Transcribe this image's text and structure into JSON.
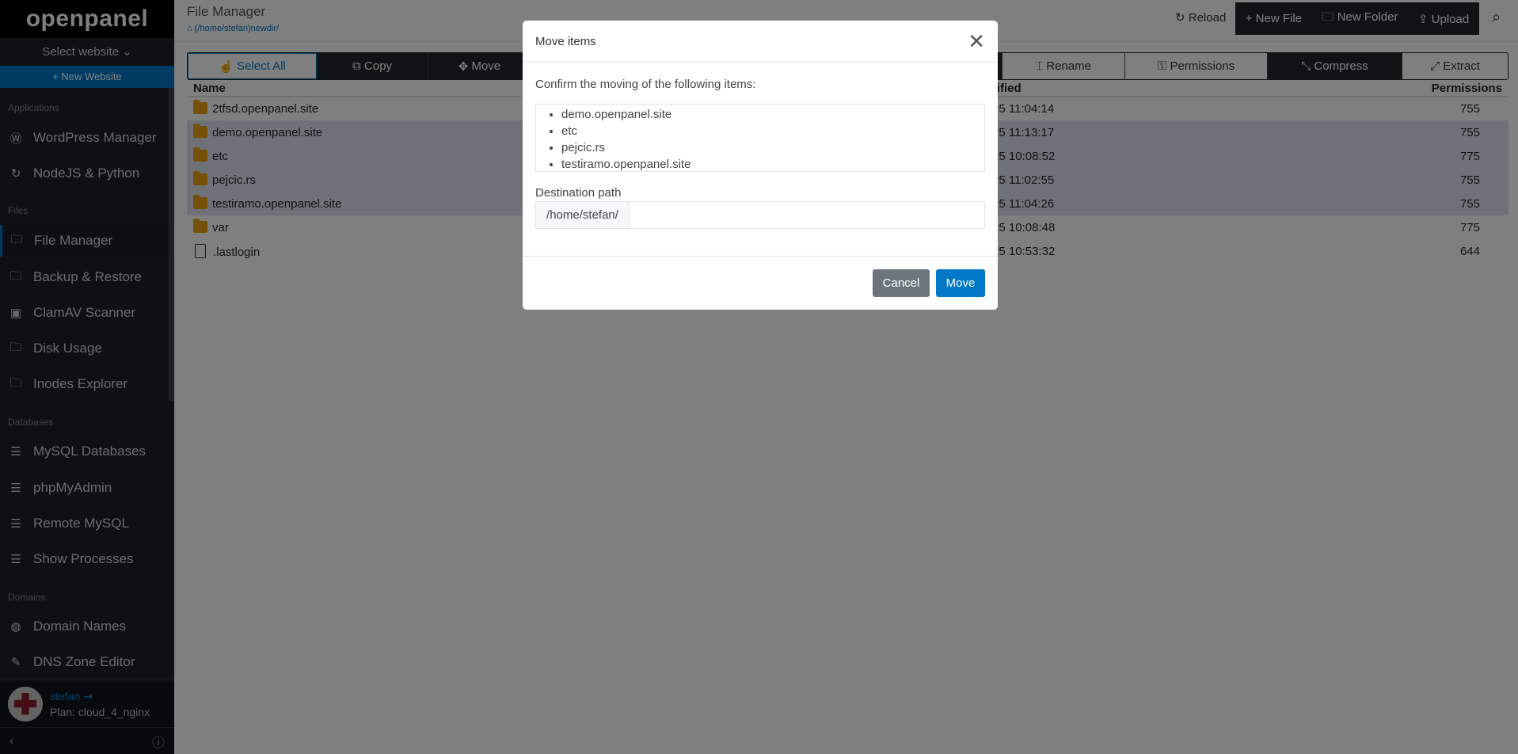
{
  "sidebar": {
    "logo": "openpanel",
    "select_website": "Select website ⌄",
    "new_website": "+ New Website",
    "sections": {
      "applications": "Applications",
      "files": "Files",
      "databases": "Databases",
      "domains": "Domains"
    },
    "items": [
      {
        "label": "WordPress Manager",
        "icon": "wordpress-icon"
      },
      {
        "label": "NodeJS & Python",
        "icon": "nodejs-icon"
      },
      {
        "label": "File Manager",
        "icon": "folder-icon"
      },
      {
        "label": "Backup & Restore",
        "icon": "backup-icon"
      },
      {
        "label": "ClamAV Scanner",
        "icon": "scanner-icon"
      },
      {
        "label": "Disk Usage",
        "icon": "disk-icon"
      },
      {
        "label": "Inodes Explorer",
        "icon": "inodes-icon"
      },
      {
        "label": "MySQL Databases",
        "icon": "database-icon"
      },
      {
        "label": "phpMyAdmin",
        "icon": "database-icon"
      },
      {
        "label": "Remote MySQL",
        "icon": "database-icon"
      },
      {
        "label": "Show Processes",
        "icon": "database-icon"
      },
      {
        "label": "Domain Names",
        "icon": "globe-icon"
      },
      {
        "label": "DNS Zone Editor",
        "icon": "edit-icon"
      }
    ],
    "user": {
      "name": "stefan",
      "plan": "Plan: cloud_4_nginx"
    }
  },
  "header": {
    "title": "File Manager",
    "breadcrumb": "(/home/stefan)newdir/",
    "reload": "Reload",
    "new_file": "+ New File",
    "new_folder": "New Folder",
    "upload": "Upload"
  },
  "toolbar": {
    "select_all": "Select All",
    "copy": "Copy",
    "move": "Move",
    "rename": "Rename",
    "permissions": "Permissions",
    "compress": "Compress",
    "extract": "Extract"
  },
  "table": {
    "columns": [
      "Name",
      "Last Modified",
      "Permissions"
    ],
    "rows": [
      {
        "name": "2tfsd.openpanel.site",
        "type": "folder",
        "modified": "2023-12-25 11:04:14",
        "perm": "755",
        "selected": false
      },
      {
        "name": "demo.openpanel.site",
        "type": "folder",
        "modified": "2023-12-25 11:13:17",
        "perm": "755",
        "selected": true
      },
      {
        "name": "etc",
        "type": "folder",
        "modified": "2023-12-25 10:08:52",
        "perm": "775",
        "selected": true
      },
      {
        "name": "pejcic.rs",
        "type": "folder",
        "modified": "2023-12-25 11:02:55",
        "perm": "755",
        "selected": true
      },
      {
        "name": "testiramo.openpanel.site",
        "type": "folder",
        "modified": "2023-12-25 11:04:26",
        "perm": "755",
        "selected": true
      },
      {
        "name": "var",
        "type": "folder",
        "modified": "2023-12-25 10:08:48",
        "perm": "775",
        "selected": false
      },
      {
        "name": ".lastlogin",
        "type": "file",
        "modified": "2023-12-25 10:53:32",
        "perm": "644",
        "selected": false
      }
    ]
  },
  "modal": {
    "title": "Move items",
    "confirm_text": "Confirm the moving of the following items:",
    "items": [
      "demo.openpanel.site",
      "etc",
      "pejcic.rs",
      "testiramo.openpanel.site"
    ],
    "dest_label": "Destination path",
    "dest_prefix": "/home/stefan/",
    "dest_value": "",
    "cancel": "Cancel",
    "move": "Move"
  },
  "colors": {
    "accent": "#0077c7",
    "folder": "#e8a20c",
    "cancel": "#6c757d"
  }
}
